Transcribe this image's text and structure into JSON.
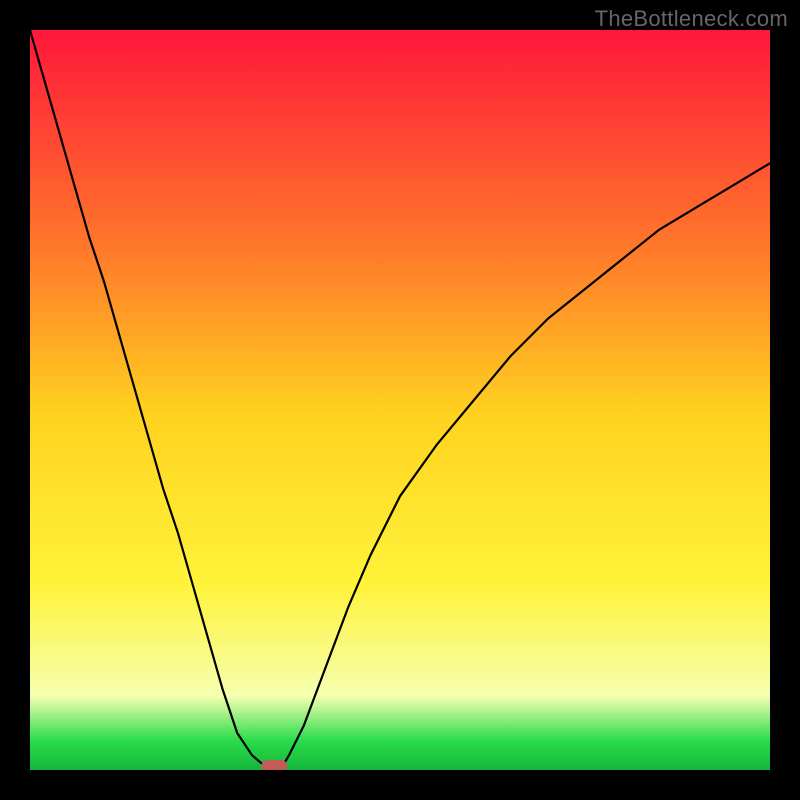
{
  "attribution": "TheBottleneck.com",
  "colors": {
    "frame": "#000000",
    "curve": "#000000",
    "marker_fill": "#c45a5a",
    "marker_stroke": "#9c3f3f",
    "gradient_top": "#ff173a",
    "gradient_upper_mid": "#ff7a2a",
    "gradient_mid": "#ffd21f",
    "gradient_lower_mid": "#fff33a",
    "gradient_pale": "#f6ffb0",
    "gradient_green": "#2bdc4c",
    "gradient_green_dark": "#15b53b"
  },
  "chart_data": {
    "type": "line",
    "title": "",
    "xlabel": "",
    "ylabel": "",
    "xlim": [
      0,
      1
    ],
    "ylim": [
      0,
      1
    ],
    "x": [
      0.0,
      0.02,
      0.04,
      0.06,
      0.08,
      0.1,
      0.12,
      0.14,
      0.16,
      0.18,
      0.2,
      0.22,
      0.24,
      0.26,
      0.28,
      0.3,
      0.32,
      0.33,
      0.34,
      0.35,
      0.37,
      0.4,
      0.43,
      0.46,
      0.5,
      0.55,
      0.6,
      0.65,
      0.7,
      0.75,
      0.8,
      0.85,
      0.9,
      0.95,
      1.0
    ],
    "values": [
      1.0,
      0.93,
      0.86,
      0.79,
      0.72,
      0.66,
      0.59,
      0.52,
      0.45,
      0.38,
      0.32,
      0.25,
      0.18,
      0.11,
      0.05,
      0.02,
      0.003,
      0.0,
      0.003,
      0.02,
      0.06,
      0.14,
      0.22,
      0.29,
      0.37,
      0.44,
      0.5,
      0.56,
      0.61,
      0.65,
      0.69,
      0.73,
      0.76,
      0.79,
      0.82
    ],
    "minimum": {
      "x": 0.33,
      "y": 0.0
    },
    "marker": {
      "x": 0.33,
      "y": 0.0,
      "shape": "rounded-rect"
    },
    "notes": "V-shaped curve over rainbow gradient; curve hits 0 near x≈0.33; right branch rises with diminishing slope."
  }
}
